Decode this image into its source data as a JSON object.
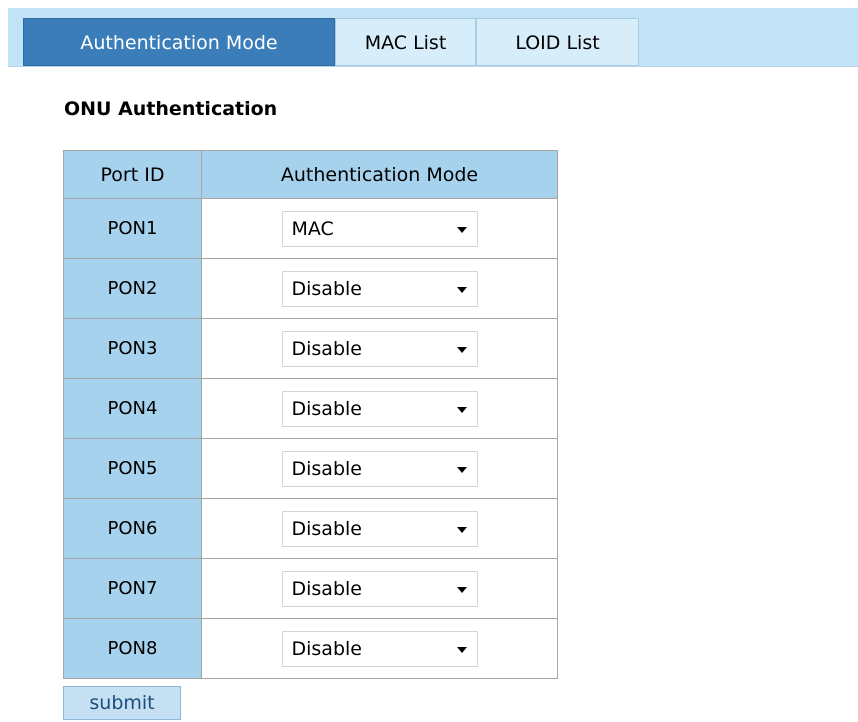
{
  "tabs": [
    {
      "label": "Authentication Mode",
      "active": true
    },
    {
      "label": "MAC List",
      "active": false
    },
    {
      "label": "LOID List",
      "active": false
    }
  ],
  "section_title": "ONU Authentication",
  "table": {
    "headers": {
      "port": "Port ID",
      "mode": "Authentication Mode"
    },
    "rows": [
      {
        "port": "PON1",
        "mode": "MAC"
      },
      {
        "port": "PON2",
        "mode": "Disable"
      },
      {
        "port": "PON3",
        "mode": "Disable"
      },
      {
        "port": "PON4",
        "mode": "Disable"
      },
      {
        "port": "PON5",
        "mode": "Disable"
      },
      {
        "port": "PON6",
        "mode": "Disable"
      },
      {
        "port": "PON7",
        "mode": "Disable"
      },
      {
        "port": "PON8",
        "mode": "Disable"
      }
    ]
  },
  "submit_label": "submit",
  "colors": {
    "tab_active": "#3a7db8",
    "tab_bar": "#c2e2f5",
    "header_cell": "#a6d2ee"
  }
}
